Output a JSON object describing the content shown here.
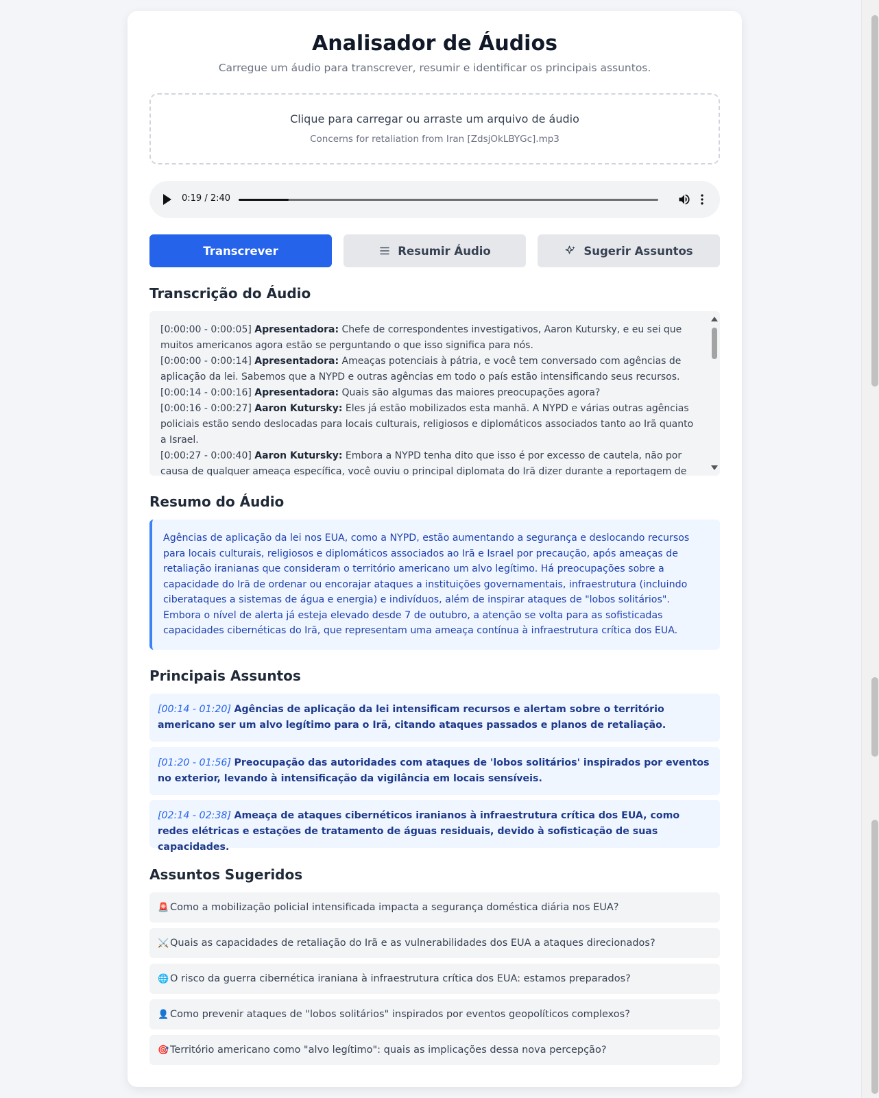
{
  "header": {
    "title": "Analisador de Áudios",
    "subtitle": "Carregue um áudio para transcrever, resumir e identificar os principais assuntos."
  },
  "upload": {
    "prompt": "Clique para carregar ou arraste um arquivo de áudio",
    "filename": "Concerns for retaliation from Iran [ZdsjOkLBYGc].mp3"
  },
  "player": {
    "time": "0:19 / 2:40",
    "progress_fraction": 0.119
  },
  "actions": {
    "transcribe": "Transcrever",
    "summarize": "Resumir Áudio",
    "suggest": "Sugerir Assuntos"
  },
  "transcript": {
    "heading": "Transcrição do Áudio",
    "entries": [
      {
        "time": "[0:00:00 - 0:00:05]",
        "speaker": "Apresentadora:",
        "text": "Chefe de correspondentes investigativos, Aaron Kutursky, e eu sei que muitos americanos agora estão se perguntando o que isso significa para nós."
      },
      {
        "time": "[0:00:00 - 0:00:14]",
        "speaker": "Apresentadora:",
        "text": "Ameaças potenciais à pátria, e você tem conversado com agências de aplicação da lei. Sabemos que a NYPD e outras agências em todo o país estão intensificando seus recursos."
      },
      {
        "time": "[0:00:14 - 0:00:16]",
        "speaker": "Apresentadora:",
        "text": "Quais são algumas das maiores preocupações agora?"
      },
      {
        "time": "[0:00:16 - 0:00:27]",
        "speaker": "Aaron Kutursky:",
        "text": "Eles já estão mobilizados esta manhã. A NYPD e várias outras agências policiais estão sendo deslocadas para locais culturais, religiosos e diplomáticos associados tanto ao Irã quanto a Israel."
      },
      {
        "time": "[0:00:27 - 0:00:40]",
        "speaker": "Aaron Kutursky:",
        "text": "Embora a NYPD tenha dito que isso é por excesso de cautela, não por causa de qualquer ameaça específica, você ouviu o principal diplomata do Irã dizer durante a reportagem de Ian que seu país reserva todas as opções para retaliar."
      }
    ]
  },
  "summary": {
    "heading": "Resumo do Áudio",
    "text": "Agências de aplicação da lei nos EUA, como a NYPD, estão aumentando a segurança e deslocando recursos para locais culturais, religiosos e diplomáticos associados ao Irã e Israel por precaução, após ameaças de retaliação iranianas que consideram o território americano um alvo legítimo. Há preocupações sobre a capacidade do Irã de ordenar ou encorajar ataques a instituições governamentais, infraestrutura (incluindo ciberataques a sistemas de água e energia) e indivíduos, além de inspirar ataques de \"lobos solitários\". Embora o nível de alerta já esteja elevado desde 7 de outubro, a atenção se volta para as sofisticadas capacidades cibernéticas do Irã, que representam uma ameaça contínua à infraestrutura crítica dos EUA."
  },
  "topics": {
    "heading": "Principais Assuntos",
    "items": [
      {
        "time": "[00:14 - 01:20]",
        "text": "Agências de aplicação da lei intensificam recursos e alertam sobre o território americano ser um alvo legítimo para o Irã, citando ataques passados e planos de retaliação."
      },
      {
        "time": "[01:20 - 01:56]",
        "text": "Preocupação das autoridades com ataques de 'lobos solitários' inspirados por eventos no exterior, levando à intensificação da vigilância em locais sensíveis."
      },
      {
        "time": "[02:14 - 02:38]",
        "text": "Ameaça de ataques cibernéticos iranianos à infraestrutura crítica dos EUA, como redes elétricas e estações de tratamento de águas residuais, devido à sofisticação de suas capacidades."
      }
    ]
  },
  "suggested": {
    "heading": "Assuntos Sugeridos",
    "items": [
      {
        "emoji": "🚨",
        "text": "Como a mobilização policial intensificada impacta a segurança doméstica diária nos EUA?"
      },
      {
        "emoji": "⚔️",
        "text": "Quais as capacidades de retaliação do Irã e as vulnerabilidades dos EUA a ataques direcionados?"
      },
      {
        "emoji": "🌐",
        "text": "O risco da guerra cibernética iraniana à infraestrutura crítica dos EUA: estamos preparados?"
      },
      {
        "emoji": "👤",
        "text": "Como prevenir ataques de \"lobos solitários\" inspirados por eventos geopolíticos complexos?"
      },
      {
        "emoji": "🎯",
        "text": "Território americano como \"alvo legítimo\": quais as implicações dessa nova percepção?"
      }
    ]
  },
  "colors": {
    "primary": "#2563eb",
    "summary_bg": "#eff6ff",
    "summary_border": "#3b82f6",
    "summary_text": "#1e40af"
  }
}
